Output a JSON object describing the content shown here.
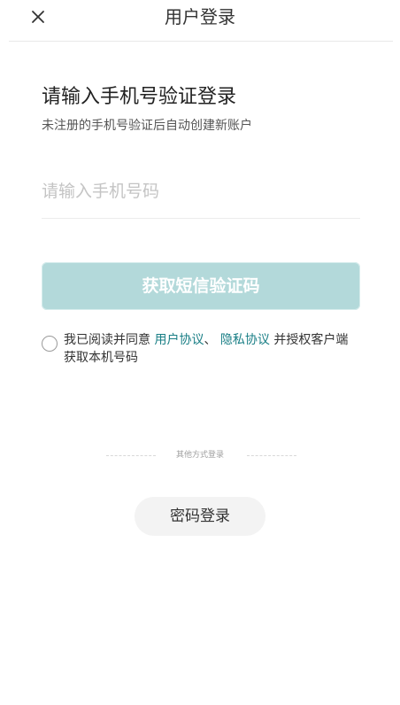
{
  "header": {
    "title": "用户登录",
    "close_icon": "close-icon"
  },
  "main": {
    "heading": "请输入手机号验证登录",
    "subheading": "未注册的手机号验证后自动创建新账户",
    "phone_input": {
      "value": "",
      "placeholder": "请输入手机号码"
    },
    "sms_button_label": "获取短信验证码",
    "sms_button_color": "#b3d9da",
    "agreement": {
      "prefix": "我已阅读并同意 ",
      "user_agreement": "用户协议",
      "separator": "、 ",
      "privacy_agreement": "隐私协议",
      "suffix": " 并授权客户端获取本机号码",
      "checked": false,
      "link_color": "#1a7f86"
    }
  },
  "other_login": {
    "label": "其他方式登录",
    "password_login_label": "密码登录"
  }
}
